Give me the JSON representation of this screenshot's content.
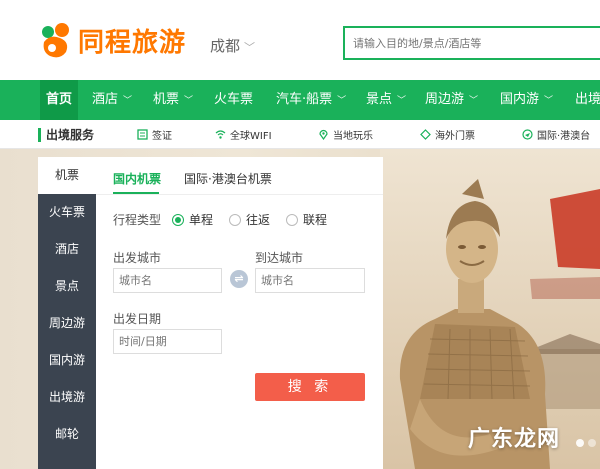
{
  "header": {
    "brand": "同程旅游",
    "city": "成都",
    "search_placeholder": "请输入目的地/景点/酒店等"
  },
  "nav": {
    "items": [
      {
        "label": "首页",
        "has_dropdown": false
      },
      {
        "label": "酒店",
        "has_dropdown": true
      },
      {
        "label": "机票",
        "has_dropdown": true
      },
      {
        "label": "火车票",
        "has_dropdown": false
      },
      {
        "label": "汽车·船票",
        "has_dropdown": true
      },
      {
        "label": "景点",
        "has_dropdown": true
      },
      {
        "label": "周边游",
        "has_dropdown": true
      },
      {
        "label": "国内游",
        "has_dropdown": true
      },
      {
        "label": "出境",
        "has_dropdown": false
      }
    ]
  },
  "subnav": {
    "title": "出境服务",
    "items": [
      {
        "label": "签证",
        "icon": "visa-icon"
      },
      {
        "label": "全球WIFI",
        "icon": "wifi-icon"
      },
      {
        "label": "当地玩乐",
        "icon": "location-pin-icon"
      },
      {
        "label": "海外门票",
        "icon": "ticket-icon"
      },
      {
        "label": "国际·港澳台",
        "icon": "plane-icon"
      }
    ]
  },
  "side_tabs": [
    "机票",
    "火车票",
    "酒店",
    "景点",
    "周边游",
    "国内游",
    "出境游",
    "邮轮"
  ],
  "form": {
    "tabs": [
      "国内机票",
      "国际·港澳台机票"
    ],
    "trip_type_label": "行程类型",
    "trip_options": [
      "单程",
      "往返",
      "联程"
    ],
    "selected_trip": "单程",
    "from_label": "出发城市",
    "to_label": "到达城市",
    "from_placeholder": "城市名",
    "to_placeholder": "城市名",
    "swap_symbol": "⇌",
    "date_label": "出发日期",
    "date_placeholder": "时间/日期",
    "search_label": "搜 索"
  },
  "banner": {
    "watermark": "广东龙网"
  },
  "colors": {
    "brand_green": "#1ab15a",
    "brand_orange": "#ff7800",
    "search_button": "#f35e4a",
    "sidebar_dark": "#3b4450"
  }
}
